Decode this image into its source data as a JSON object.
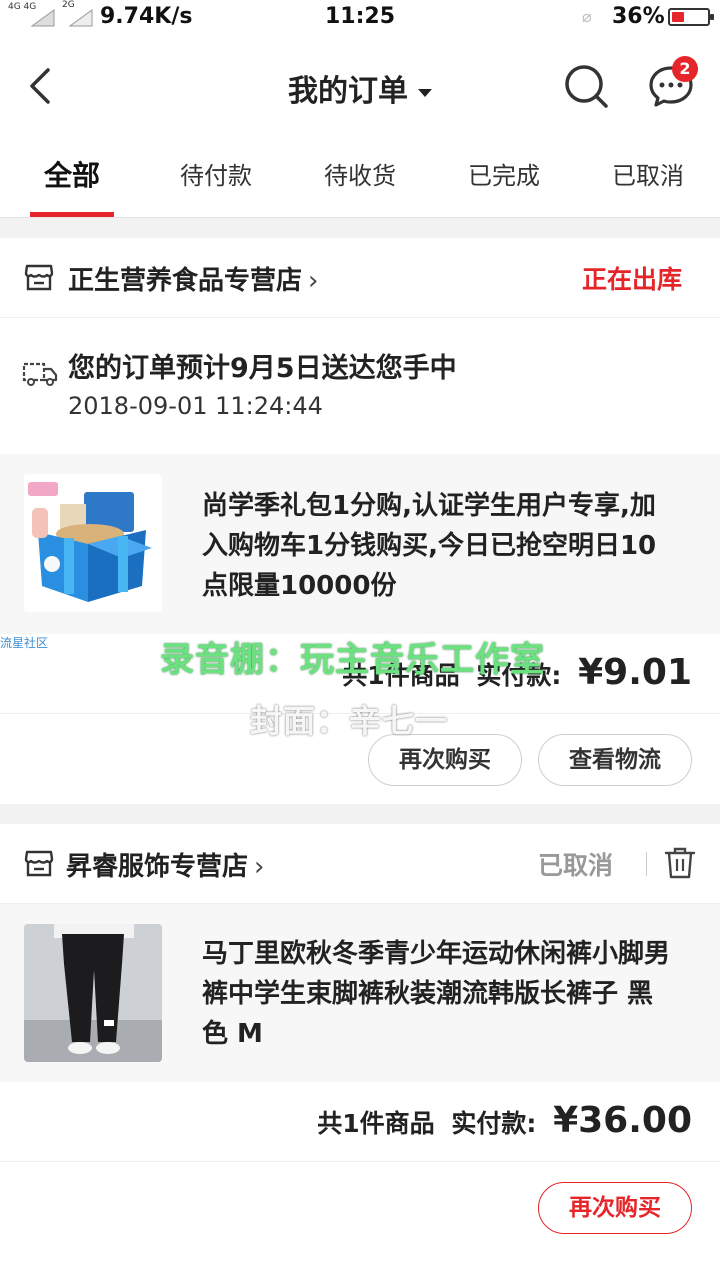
{
  "status_bar": {
    "network1": "4G 4G",
    "network2": "2G",
    "speed": "9.74K/s",
    "time": "11:25",
    "battery_percent": "36%",
    "battery_level": 0.36,
    "battery_color": "#e5252a"
  },
  "header": {
    "title": "我的订单",
    "badge_count": "2"
  },
  "tabs": [
    {
      "label": "全部",
      "active": true
    },
    {
      "label": "待付款",
      "active": false
    },
    {
      "label": "待收货",
      "active": false
    },
    {
      "label": "已完成",
      "active": false
    },
    {
      "label": "已取消",
      "active": false
    }
  ],
  "orders": [
    {
      "shop_name": "正生营养食品专营店",
      "shop_chevron": "›",
      "status": "正在出库",
      "status_color": "#e5252a",
      "delivery_text": "您的订单预计9月5日送达您手中",
      "delivery_time": "2018-09-01 11:24:44",
      "item_title": "尚学季礼包1分购,认证学生用户专享,加入购物车1分钱购买,今日已抢空明日10点限量10000份",
      "summary_count": "共1件商品",
      "summary_label": "实付款:",
      "summary_price": "¥9.01",
      "buttons": [
        "再次购买",
        "查看物流"
      ]
    },
    {
      "shop_name": "昇睿服饰专营店",
      "shop_chevron": "›",
      "status": "已取消",
      "status_color": "#999999",
      "item_title": "马丁里欧秋冬季青少年运动休闲裤小脚男裤中学生束脚裤秋装潮流韩版长裤子 黑色 M",
      "summary_count": "共1件商品",
      "summary_label": "实付款:",
      "summary_price": "¥36.00",
      "buttons": [
        "再次购买"
      ]
    }
  ],
  "watermarks": {
    "community": "流星社区",
    "studio": "录音棚：玩主音乐工作室",
    "cover": "封面：辛七一"
  }
}
